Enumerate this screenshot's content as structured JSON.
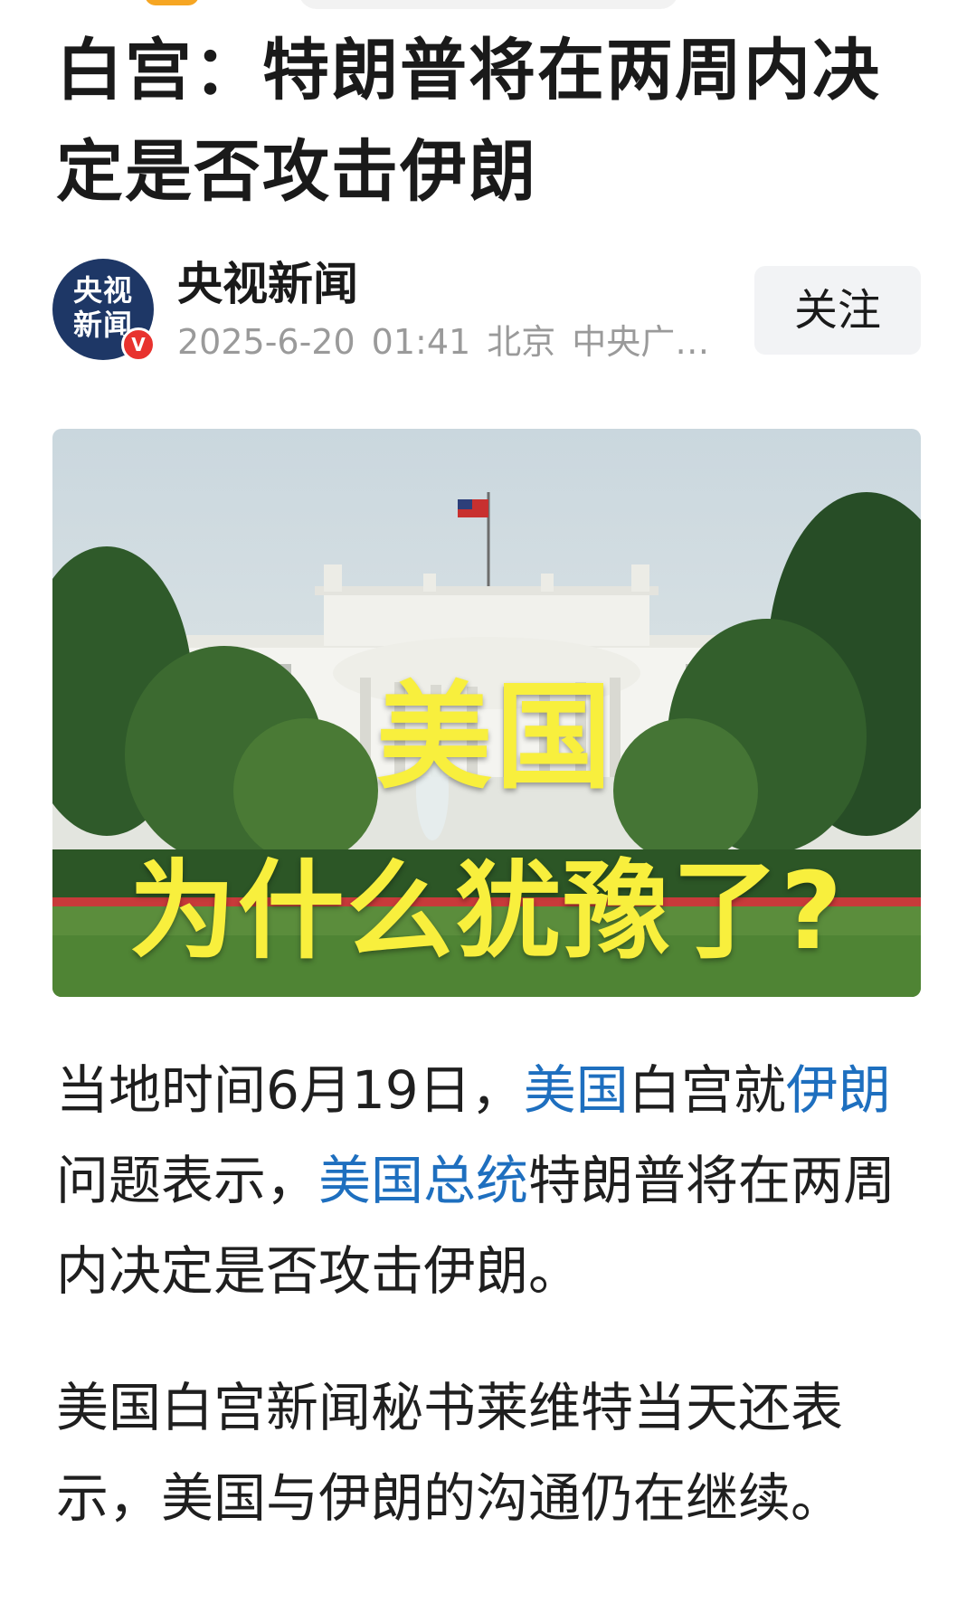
{
  "article": {
    "title": "白宫：特朗普将在两周内决定是否攻击伊朗"
  },
  "author": {
    "avatar_line1": "央视",
    "avatar_line2": "新闻",
    "verified_mark": "V",
    "name": "央视新闻",
    "date": "2025-6-20",
    "time": "01:41",
    "location": "北京",
    "source": "中央广…",
    "follow_label": "关注"
  },
  "hero": {
    "overlay_line1": "美国",
    "overlay_line2": "为什么犹豫了?"
  },
  "paragraph1": {
    "part1": "当地时间6月19日，",
    "link1": "美国",
    "part2": "白宫就",
    "link2": "伊朗",
    "part3": "问题表示，",
    "link3": "美国总统",
    "part4": "特朗普将在两周内决定是否攻击伊朗。"
  },
  "paragraph2": {
    "text": "美国白宫新闻秘书莱维特当天还表示，美国与伊朗的沟通仍在继续。"
  },
  "colors": {
    "link": "#1e6fbf",
    "overlay_text": "#f8ef3d",
    "avatar_bg": "#1e3766",
    "verified": "#e8322e"
  },
  "icons": [
    "verified-badge-icon"
  ]
}
